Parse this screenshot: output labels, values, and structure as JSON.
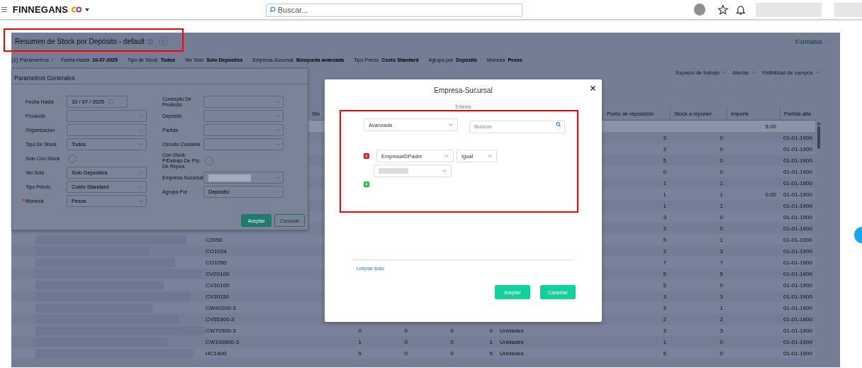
{
  "top_bar": {
    "brand": "FINNEGANS",
    "search": {
      "placeholder": "Buscar..."
    }
  },
  "report": {
    "title": "Resumen de Stock por Depósito - default",
    "formats": "Formatos"
  },
  "summary": {
    "params_link": "(1) Parámetros",
    "filters": [
      {
        "label": "Fecha Hasta",
        "value": "10-07-2025"
      },
      {
        "label": "Tipo de Stock",
        "value": "Todos"
      },
      {
        "label": "Ver Solo",
        "value": "Solo Depositos"
      },
      {
        "label": "Empresa-Sucursal",
        "value": "Búsqueda avanzada"
      },
      {
        "label": "Tipo Precio",
        "value": "Costo Standard"
      },
      {
        "label": "Agrupa por",
        "value": "Depósito"
      },
      {
        "label": "Moneda",
        "value": "Pesos"
      }
    ]
  },
  "toolbar_links": [
    "Espacio de trabajo",
    "Alertas",
    "Visibilidad de campos"
  ],
  "parameters_panel": {
    "title": "Parametros Generales",
    "left_fields": [
      {
        "label": "Fecha Hasta",
        "kind": "date",
        "value": "10 / 07 / 2025"
      },
      {
        "label": "Producto",
        "kind": "select"
      },
      {
        "label": "Organizacion",
        "kind": "select"
      },
      {
        "label": "Tipo De Stock",
        "kind": "select",
        "value": "Todos"
      },
      {
        "label": "Solo Con Stock",
        "kind": "radio",
        "checked": false
      },
      {
        "label": "Ver Solo",
        "kind": "select",
        "value": "Solo Depositos"
      },
      {
        "label": "Tipo Precio",
        "kind": "select",
        "value": "Costo Standard"
      },
      {
        "label": "Moneda",
        "kind": "select",
        "value": "Pesos",
        "required": true
      }
    ],
    "right_fields": [
      {
        "label": "Concepto De Producto",
        "kind": "select"
      },
      {
        "label": "Depósito",
        "kind": "select"
      },
      {
        "label": "Partida",
        "kind": "select"
      },
      {
        "label": "Circuito Contable",
        "kind": "select"
      },
      {
        "label": "Con Stock P/Debajo De Pto. De Repos.",
        "kind": "radio",
        "checked": false
      },
      {
        "label": "Empresa-Sucursal",
        "kind": "select",
        "value_hidden": true
      },
      {
        "label": "Agrupa Por",
        "kind": "select",
        "value": "Depósito"
      }
    ],
    "buttons": [
      {
        "label": "Aceptar",
        "kind": "filled"
      },
      {
        "label": "Cancelar",
        "kind": "outline"
      }
    ]
  },
  "table": {
    "headers": {
      "column_3": "Sto",
      "punto_de_reposicion": "Punto de reposición",
      "stock_a_reponer": "Stock a reponer",
      "importe": "Importe",
      "partida_alta": "Partida alta"
    },
    "total_row": {
      "importe": "5.00"
    },
    "rows": [
      {
        "punto_de_reposicion": "3",
        "stock_a_reponer": "0",
        "partida_alta": "01-01-1900"
      },
      {
        "punto_de_reposicion": "3",
        "stock_a_reponer": "0",
        "partida_alta": "01-01-1900"
      },
      {
        "punto_de_reposicion": "5",
        "stock_a_reponer": "0",
        "partida_alta": "01-01-1900"
      },
      {
        "punto_de_reposicion": "0",
        "stock_a_reponer": "0",
        "partida_alta": "01-01-1900"
      },
      {
        "punto_de_reposicion": "1",
        "stock_a_reponer": "1",
        "partida_alta": "01-01-1900"
      },
      {
        "punto_de_reposicion": "1",
        "stock_a_reponer": "1",
        "importe": "0.00",
        "partida_alta": "01-01-1900"
      },
      {
        "punto_de_reposicion": "1",
        "stock_a_reponer": "1",
        "partida_alta": "01-01-1900"
      },
      {
        "punto_de_reposicion": "3",
        "stock_a_reponer": "0",
        "partida_alta": "01-01-1900"
      },
      {
        "punto_de_reposicion": "3",
        "stock_a_reponer": "0",
        "partida_alta": "01-01-1900"
      },
      {
        "description_hidden": true,
        "code": "C2050",
        "punto_de_reposicion": "5",
        "stock_a_reponer": "1",
        "partida_alta": "01-01-1900"
      },
      {
        "description_hidden": true,
        "code": "CO1024",
        "punto_de_reposicion": "3",
        "stock_a_reponer": "3",
        "partida_alta": "01-01-1900"
      },
      {
        "description_hidden": true,
        "code": "CO1050",
        "punto_de_reposicion": "7",
        "stock_a_reponer": "7",
        "partida_alta": "01-01-1900"
      },
      {
        "description_hidden": true,
        "code": "CV20100",
        "punto_de_reposicion": "5",
        "stock_a_reponer": "5",
        "partida_alta": "01-01-1900"
      },
      {
        "description_hidden": true,
        "code": "CV30100",
        "punto_de_reposicion": "5",
        "stock_a_reponer": "0",
        "partida_alta": "01-01-1900"
      },
      {
        "description_hidden": true,
        "code": "CV30150",
        "punto_de_reposicion": "3",
        "stock_a_reponer": "3",
        "partida_alta": "01-01-1900"
      },
      {
        "description_hidden": true,
        "code": "CW40200-3",
        "punto_de_reposicion": "3",
        "stock_a_reponer": "1",
        "partida_alta": "01-01-1900"
      },
      {
        "description_hidden": true,
        "code": "CV55300-3",
        "punto_de_reposicion": "2",
        "stock_a_reponer": "2",
        "partida_alta": "01-01-1900"
      },
      {
        "description_hidden": true,
        "code": "CW70300-3",
        "column_3": "0",
        "column_4": "0",
        "column_5": "0",
        "column_6": "0",
        "unit": "Unidades",
        "punto_de_reposicion": "3",
        "stock_a_reponer": "3",
        "partida_alta": "01-01-1900"
      },
      {
        "description_hidden": true,
        "code": "CW100500-3",
        "column_3": "1",
        "column_4": "0",
        "column_5": "0",
        "column_6": "1",
        "unit": "Unidades",
        "punto_de_reposicion": "1",
        "stock_a_reponer": "0",
        "partida_alta": "01-01-1900"
      },
      {
        "description_hidden": true,
        "code": "HC1400",
        "column_3": "5",
        "column_4": "0",
        "column_5": "0",
        "column_6": "5",
        "unit": "Unidades",
        "punto_de_reposicion": "5",
        "stock_a_reponer": "0",
        "partida_alta": "01-01-1900"
      }
    ]
  },
  "modal": {
    "title": "Empresa-Sucursal",
    "count": "5 items",
    "mode_select": {
      "value": "Avanzada"
    },
    "search": {
      "placeholder": "Buscar"
    },
    "filters": [
      {
        "field": "EmpresaIDPadre",
        "operator": "Igual",
        "value_hidden": true
      }
    ],
    "clear_link": "Limpiar todo",
    "buttons": [
      {
        "label": "Aceptar",
        "kind": "filled"
      },
      {
        "label": "Cancelar",
        "kind": "filled"
      }
    ]
  }
}
